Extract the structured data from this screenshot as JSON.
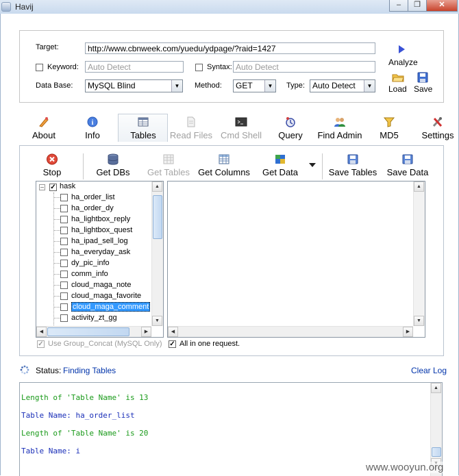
{
  "window": {
    "title": "Havij",
    "minimize": "–",
    "restore": "❐",
    "close": "✕"
  },
  "form": {
    "target_label": "Target:",
    "target_value": "http://www.cbnweek.com/yuedu/ydpage/?raid=1427",
    "keyword_label": "Keyword:",
    "keyword_placeholder": "Auto Detect",
    "syntax_label": "Syntax:",
    "syntax_placeholder": "Auto Detect",
    "database_label": "Data Base:",
    "database_value": "MySQL Blind",
    "method_label": "Method:",
    "method_value": "GET",
    "type_label": "Type:",
    "type_value": "Auto Detect",
    "analyze_label": "Analyze",
    "load_label": "Load",
    "save_label": "Save"
  },
  "tabs": [
    {
      "label": "About",
      "icon": "about-icon",
      "enabled": true
    },
    {
      "label": "Info",
      "icon": "info-icon",
      "enabled": true
    },
    {
      "label": "Tables",
      "icon": "tables-icon",
      "enabled": true,
      "selected": true
    },
    {
      "label": "Read Files",
      "icon": "read-files-icon",
      "enabled": false
    },
    {
      "label": "Cmd Shell",
      "icon": "cmd-shell-icon",
      "enabled": false
    },
    {
      "label": "Query",
      "icon": "query-icon",
      "enabled": true
    },
    {
      "label": "Find Admin",
      "icon": "find-admin-icon",
      "enabled": true
    },
    {
      "label": "MD5",
      "icon": "md5-icon",
      "enabled": true
    },
    {
      "label": "Settings",
      "icon": "settings-icon",
      "enabled": true
    }
  ],
  "toolbar": {
    "stop": "Stop",
    "get_dbs": "Get DBs",
    "get_tables": "Get Tables",
    "get_columns": "Get Columns",
    "get_data": "Get Data",
    "save_tables": "Save Tables",
    "save_data": "Save Data"
  },
  "tree": {
    "root": "hask",
    "items": [
      "ha_order_list",
      "ha_order_dy",
      "ha_lightbox_reply",
      "ha_lightbox_quest",
      "ha_ipad_sell_log",
      "ha_everyday_ask",
      "dy_pic_info",
      "comm_info",
      "cloud_maga_note",
      "cloud_maga_favorite",
      "cloud_maga_comment",
      "activity_zt_gg"
    ],
    "selected_index": 10
  },
  "options": {
    "group_concat": "Use Group_Concat (MySQL Only)",
    "all_in_one": "All in one request."
  },
  "status": {
    "label": "Status:",
    "value": "Finding Tables",
    "clear_log": "Clear Log"
  },
  "log": [
    {
      "text": "Length of 'Table Name' is 13",
      "color": "#1a9a1a"
    },
    {
      "text": "Table Name: ha_order_list",
      "color": "#1a2fb8"
    },
    {
      "text": "Length of 'Table Name' is 20",
      "color": "#1a9a1a"
    },
    {
      "text": "Table Name: i",
      "color": "#1a2fb8"
    }
  ],
  "watermark": "www.wooyun.org",
  "colors": {
    "green_log": "#1a9a1a",
    "blue_log": "#1a2fb8",
    "status_value": "#0033aa",
    "selection": "#3399ff"
  }
}
